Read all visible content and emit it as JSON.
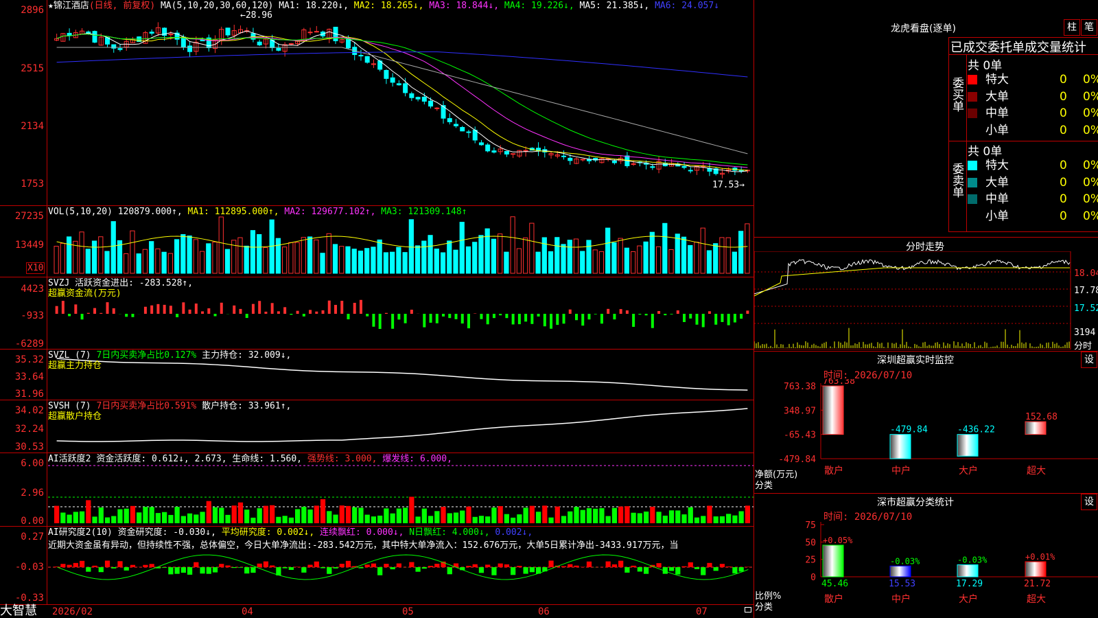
{
  "stock": {
    "name": "锦江酒店",
    "period": "(日线, 前复权)",
    "ma_label": "MA(5,10,20,30,60,120)",
    "ma1": "MA1: 18.220↓,",
    "ma2": "MA2: 18.265↓,",
    "ma3": "MA3: 18.844↓,",
    "ma4": "MA4: 19.226↓,",
    "ma5": "MA5: 21.385↓,",
    "ma6": "MA6: 24.057↓",
    "high_mark": "←28.96",
    "low_mark": "17.53→",
    "price_axis": [
      "2896",
      "2515",
      "2134",
      "1753"
    ]
  },
  "volume": {
    "label": "VOL(5,10,20)",
    "value": "120879.000↑,",
    "ma1": "MA1: 112895.000↑,",
    "ma2": "MA2: 129677.102↑,",
    "ma3": "MA3: 121309.148↑",
    "axis": [
      "27235",
      "13449"
    ],
    "unit": "X10"
  },
  "svzj": {
    "label": "SVZJ  活跃资金进出: -283.528↑,",
    "sub": "超赢资金流(万元)",
    "axis": [
      "4423",
      "-933",
      "-6289"
    ]
  },
  "svzl": {
    "label": "SVZL (7)",
    "ratio": "7日内买卖净占比0.127%",
    "hold": "主力持仓: 32.009↓,",
    "sub": "超赢主力持仓",
    "axis": [
      "35.32",
      "33.64",
      "31.96"
    ]
  },
  "svsh": {
    "label": "SVSH (7)",
    "ratio": "7日内买卖净占比0.591%",
    "hold": "散户持仓: 33.961↑,",
    "sub": "超赢散户持仓",
    "axis": [
      "34.02",
      "32.24",
      "30.53"
    ]
  },
  "ai_active": {
    "label": "AI活跃度2",
    "val": "资金活跃度: 0.612↓,",
    "val2": "2.673,",
    "life": "生命线: 1.560,",
    "strong": "强势线: 3.000,",
    "burst": "爆发线: 6.000,",
    "axis": [
      "6.00",
      "2.96",
      "0.00"
    ]
  },
  "ai_research": {
    "label": "AI研究度2(10)",
    "val": "资金研究度: -0.030↓,",
    "avg": "平均研究度: 0.002↓,",
    "cont": "连续飘红: 0.000↓,",
    "nday": "N日飘红: 4.000↓,",
    "last": "0.002↓,",
    "comment": "近期大资金虽有异动，但持续性不强，总体偏空，今日大单净流出:-283.542万元，其中特大单净流入：152.676万元，大单5日累计净出-3433.917万元，当",
    "axis": [
      "0.27",
      "-0.03",
      "-0.33"
    ]
  },
  "time_axis": {
    "brand": "大智慧",
    "labels": [
      "2026/02",
      "04",
      "05",
      "06",
      "07"
    ]
  },
  "dragon": {
    "title": "龙虎看盘(逐单)",
    "btn_zhu": "柱",
    "btn_bi": "笔",
    "section_title": "已成交委托单成交量统计",
    "buy_label": "委买单",
    "sell_label": "委卖单",
    "buy_total": "共 0单",
    "sell_total": "共 0单",
    "buy_rows": [
      {
        "name": "特大",
        "n": "0",
        "p": "0%",
        "color": "#ff0000"
      },
      {
        "name": "大单",
        "n": "0",
        "p": "0%",
        "color": "#8b0000"
      },
      {
        "name": "中单",
        "n": "0",
        "p": "0%",
        "color": "#6b0000"
      },
      {
        "name": "小单",
        "n": "0",
        "p": "0%",
        "color": "#000000"
      }
    ],
    "sell_rows": [
      {
        "name": "特大",
        "n": "0",
        "p": "0%",
        "color": "#00ffff"
      },
      {
        "name": "大单",
        "n": "0",
        "p": "0%",
        "color": "#008b8b"
      },
      {
        "name": "中单",
        "n": "0",
        "p": "0%",
        "color": "#006b6b"
      },
      {
        "name": "小单",
        "n": "0",
        "p": "0%",
        "color": "#000000"
      }
    ]
  },
  "intraday": {
    "title": "分时走势",
    "axis": [
      "18.04",
      "17.78",
      "17.52"
    ],
    "vol": "3194",
    "vol_unit": "分时"
  },
  "sz_monitor": {
    "title": "深圳超赢实时监控",
    "btn": "设",
    "time": "时间: 2026/07/10",
    "axis": [
      "763.38",
      "348.97",
      "-65.43",
      "-479.84"
    ],
    "ylabel": "净额(万元)",
    "xlabel": "分类",
    "bars": [
      {
        "cat": "散户",
        "value": 763.38,
        "label": "763.38"
      },
      {
        "cat": "中户",
        "value": -479.84,
        "label": "-479.84"
      },
      {
        "cat": "大户",
        "value": -436.22,
        "label": "-436.22"
      },
      {
        "cat": "超大",
        "value": 152.68,
        "label": "152.68"
      }
    ]
  },
  "sz_classify": {
    "title": "深市超赢分类统计",
    "btn": "设",
    "time": "时间: 2026/07/10",
    "axis": [
      "75",
      "50",
      "25",
      "0"
    ],
    "ylabel": "比例%",
    "xlabel": "分类",
    "bars": [
      {
        "cat": "散户",
        "value": 45.46,
        "label": "45.46",
        "delta": "+0.05%"
      },
      {
        "cat": "中户",
        "value": 15.53,
        "label": "15.53",
        "delta": "-0.03%"
      },
      {
        "cat": "大户",
        "value": 17.29,
        "label": "17.29",
        "delta": "-0.03%"
      },
      {
        "cat": "超大",
        "value": 21.72,
        "label": "21.72",
        "delta": "+0.01%"
      }
    ]
  },
  "colors": {
    "frame": "#c00000",
    "up": "#ff3030",
    "down": "#00ffff",
    "ma1": "#ffffff",
    "ma2": "#ffff00",
    "ma3": "#ff33ff",
    "ma4": "#00ff00",
    "ma5": "#aaaaaa",
    "ma6": "#3030ff"
  }
}
